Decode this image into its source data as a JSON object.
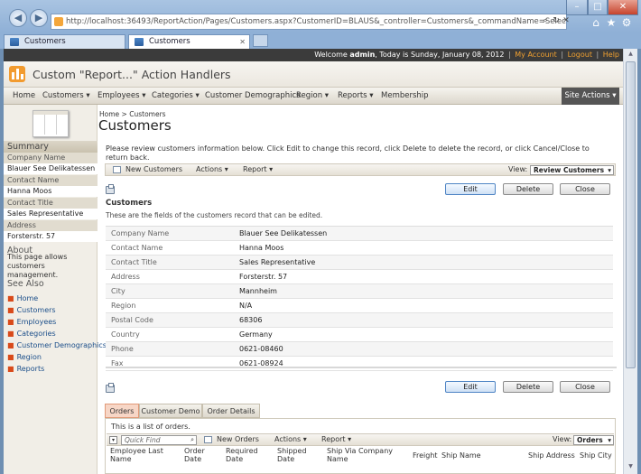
{
  "browser": {
    "url": "http://localhost:36493/ReportAction/Pages/Customers.aspx?CustomerID=BLAUS&_controller=Customers&_commandName=Select&_comma",
    "tabs": [
      {
        "label": "Customers",
        "active": false
      },
      {
        "label": "Customers",
        "active": true
      }
    ],
    "icons": [
      "back-icon",
      "forward-icon",
      "search-icon",
      "refresh-icon",
      "close-icon",
      "home-icon",
      "star-icon",
      "gear-icon",
      "minimize-icon",
      "maximize-icon",
      "window-close-icon"
    ]
  },
  "welcome": {
    "prefix": "Welcome ",
    "user": "admin",
    "date_text": ", Today is Sunday, January 08, 2012",
    "my_account": "My Account",
    "logout": "Logout",
    "help": "Help",
    "separator": "|"
  },
  "app": {
    "title": "Custom \"Report...\" Action Handlers",
    "accent_color": "#f29b2f"
  },
  "menu": {
    "items": [
      "Home",
      "Customers ▾",
      "Employees ▾",
      "Categories ▾",
      "Customer Demographics",
      "Region ▾",
      "Reports ▾",
      "Membership"
    ],
    "site_actions": "Site Actions ▾"
  },
  "sidebar": {
    "summary_title": "Summary",
    "fields": [
      {
        "label": "Company Name",
        "value": "Blauer See Delikatessen"
      },
      {
        "label": "Contact Name",
        "value": "Hanna Moos"
      },
      {
        "label": "Contact Title",
        "value": "Sales Representative"
      },
      {
        "label": "Address",
        "value": "Forsterstr. 57"
      }
    ],
    "about_title": "About",
    "about_text": "This page allows customers management.",
    "see_also_title": "See Also",
    "see_also": [
      "Home",
      "Customers",
      "Employees",
      "Categories",
      "Customer Demographics",
      "Region",
      "Reports"
    ]
  },
  "breadcrumb": {
    "home": "Home",
    "sep": ">",
    "current": "Customers"
  },
  "page_title": "Customers",
  "instructions": "Please review customers information below. Click Edit to change this record, click Delete to delete the record, or click Cancel/Close to return back.",
  "toolbar": {
    "new_label": "New Customers",
    "actions_label": "Actions ▾",
    "report_label": "Report ▾",
    "view_label": "View:",
    "view_value": "Review Customers"
  },
  "buttons": {
    "edit": "Edit",
    "delete": "Delete",
    "close": "Close"
  },
  "form": {
    "title": "Customers",
    "description": "These are the fields of the customers record that can be edited.",
    "fields": [
      {
        "label": "Company Name",
        "value": "Blauer See Delikatessen"
      },
      {
        "label": "Contact Name",
        "value": "Hanna Moos"
      },
      {
        "label": "Contact Title",
        "value": "Sales Representative"
      },
      {
        "label": "Address",
        "value": "Forsterstr. 57"
      },
      {
        "label": "City",
        "value": "Mannheim"
      },
      {
        "label": "Region",
        "value": "N/A"
      },
      {
        "label": "Postal Code",
        "value": "68306"
      },
      {
        "label": "Country",
        "value": "Germany"
      },
      {
        "label": "Phone",
        "value": "0621-08460"
      },
      {
        "label": "Fax",
        "value": "0621-08924"
      }
    ]
  },
  "child": {
    "tabs": [
      "Orders",
      "Customer Demo",
      "Order Details"
    ],
    "active_tab": "Orders",
    "note": "This is a list of orders.",
    "quick_find_placeholder": "Quick Find",
    "new_label": "New Orders",
    "actions_label": "Actions ▾",
    "report_label": "Report ▾",
    "view_label": "View:",
    "view_value": "Orders",
    "columns": [
      "Employee Last Name",
      "Order Date",
      "Required Date",
      "Shipped Date",
      "Ship Via Company Name",
      "Freight",
      "Ship Name",
      "Ship Address",
      "Ship City"
    ]
  }
}
